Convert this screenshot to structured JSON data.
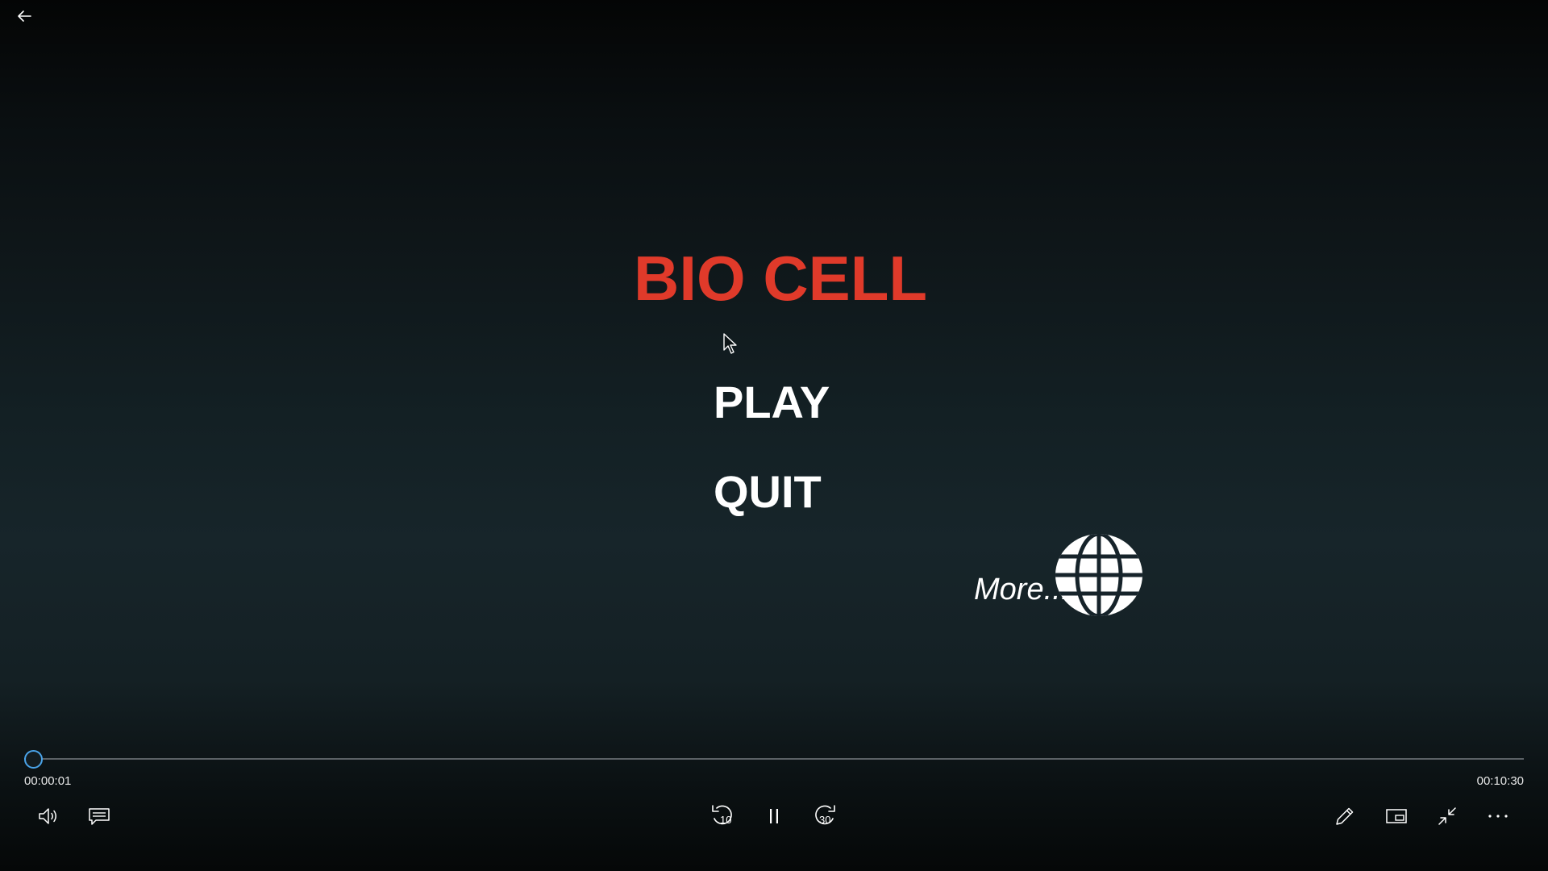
{
  "colors": {
    "title": "#e03a2a",
    "accent": "#4aa3e8",
    "text": "#ffffff"
  },
  "header": {
    "back_icon": "arrow-left-icon"
  },
  "game": {
    "title": "BIO CELL",
    "menu": {
      "play": "PLAY",
      "quit": "QUIT"
    },
    "more": {
      "label": "More...",
      "icon": "globe-icon"
    }
  },
  "player": {
    "current_time": "00:00:01",
    "total_time": "00:10:30",
    "progress_fraction": 0.0016,
    "controls": {
      "left": [
        "volume-icon",
        "captions-icon"
      ],
      "center": [
        "skip-back-10-icon",
        "pause-icon",
        "skip-forward-30-icon"
      ],
      "right": [
        "pencil-icon",
        "miniview-icon",
        "exit-fullscreen-icon",
        "more-options-icon"
      ],
      "skip_back_seconds": "10",
      "skip_forward_seconds": "30"
    }
  }
}
